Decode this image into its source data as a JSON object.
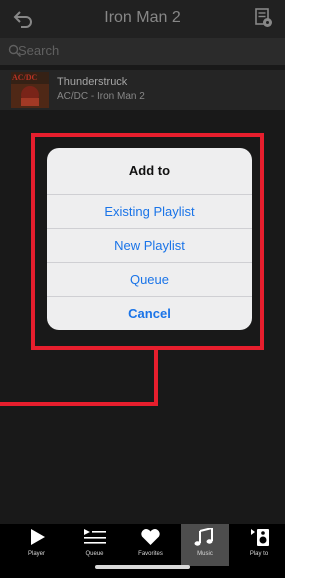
{
  "header": {
    "title": "Iron Man 2",
    "back_icon": "back-arrow-icon",
    "info_icon": "album-info-icon"
  },
  "search": {
    "placeholder": "Search",
    "icon": "search-icon"
  },
  "track": {
    "title": "Thunderstruck",
    "subtitle": "AC/DC - Iron Man 2",
    "art_text": "AC/DC"
  },
  "dialog": {
    "title": "Add to",
    "options": [
      "Existing Playlist",
      "New Playlist",
      "Queue"
    ],
    "cancel": "Cancel"
  },
  "tabbar": {
    "tabs": [
      {
        "label": "Player",
        "icon": "play-icon"
      },
      {
        "label": "Queue",
        "icon": "queue-icon"
      },
      {
        "label": "Favorites",
        "icon": "heart-icon"
      },
      {
        "label": "Music",
        "icon": "music-note-icon"
      },
      {
        "label": "Play to",
        "icon": "speaker-icon"
      }
    ],
    "active_tab": "Music"
  },
  "colors": {
    "highlight": "#e61e2d",
    "dialog_link": "#1a74e8",
    "background": "#1d1d1d"
  }
}
